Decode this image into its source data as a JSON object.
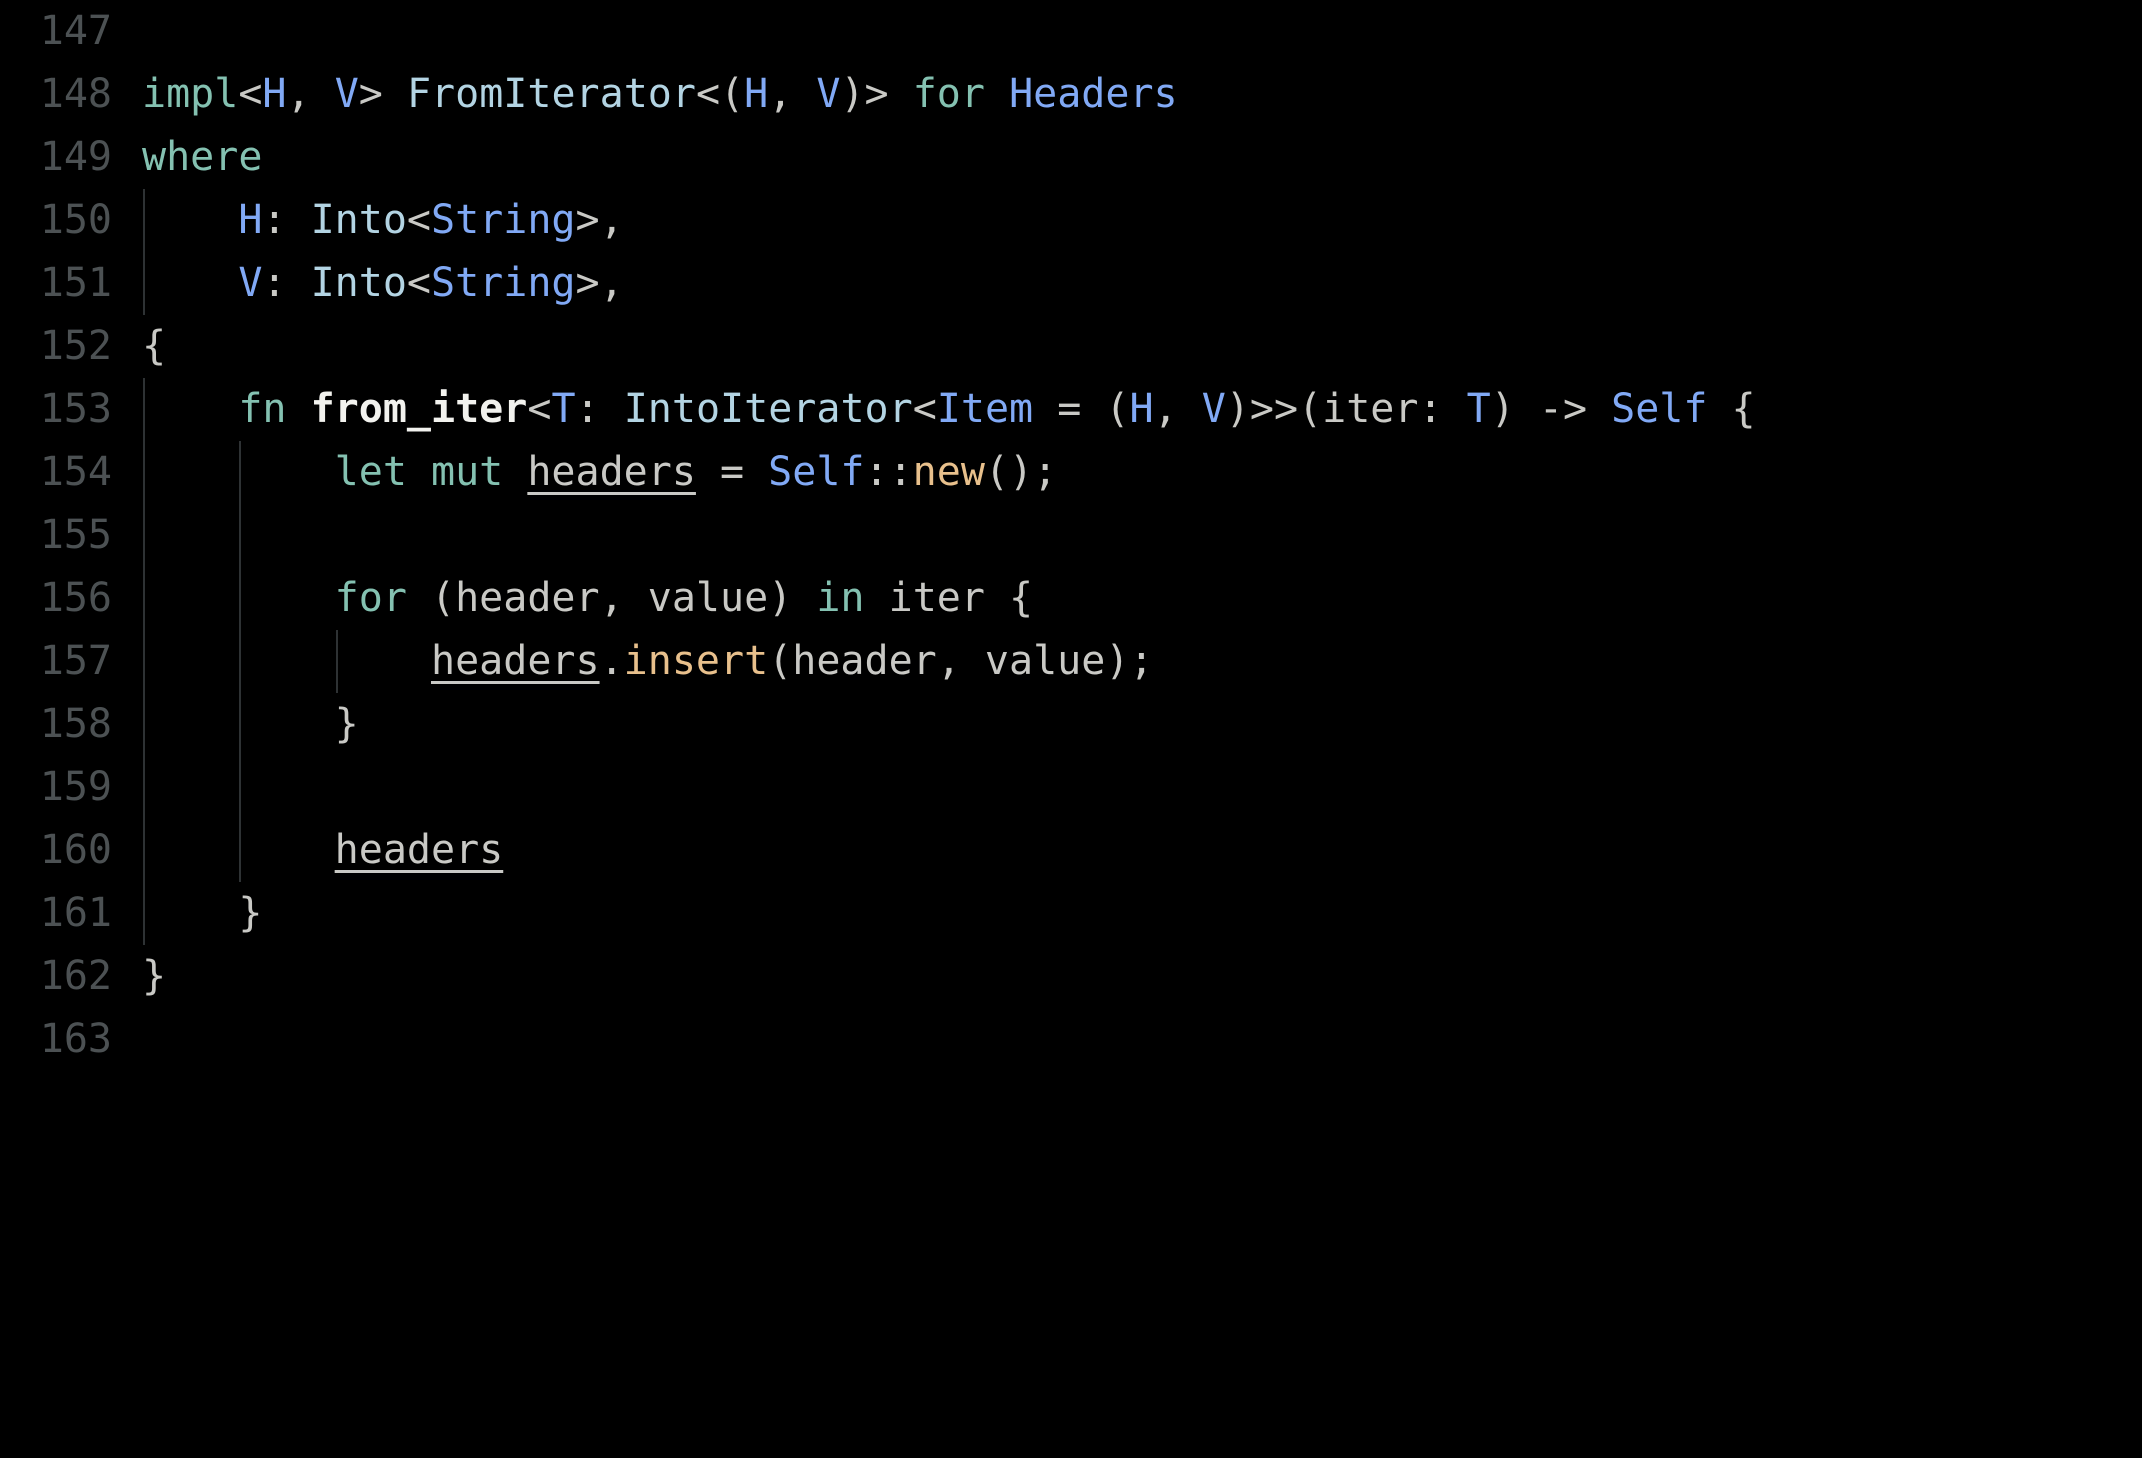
{
  "editor": {
    "language": "rust",
    "background_color": "#000000",
    "gutter_color": "#4c5153",
    "colors": {
      "keyword": "#84c1b1",
      "type": "#81a9f5",
      "trait": "#b3d4e3",
      "function_def": "#f2f2ee",
      "function_call": "#e8c08c",
      "punctuation": "#c9c9c5",
      "indent_guide": "#2e3234"
    },
    "first_line": 147,
    "last_line": 163,
    "lines": [
      {
        "number": "147",
        "guides": [],
        "tokens": []
      },
      {
        "number": "148",
        "guides": [],
        "tokens": [
          {
            "t": "impl",
            "c": "kw"
          },
          {
            "t": "<",
            "c": "pun"
          },
          {
            "t": "H",
            "c": "typ"
          },
          {
            "t": ", ",
            "c": "pun"
          },
          {
            "t": "V",
            "c": "typ"
          },
          {
            "t": "> ",
            "c": "pun"
          },
          {
            "t": "FromIterator",
            "c": "tra"
          },
          {
            "t": "<(",
            "c": "pun"
          },
          {
            "t": "H",
            "c": "typ"
          },
          {
            "t": ", ",
            "c": "pun"
          },
          {
            "t": "V",
            "c": "typ"
          },
          {
            "t": ")> ",
            "c": "pun"
          },
          {
            "t": "for",
            "c": "kw"
          },
          {
            "t": " ",
            "c": "pun"
          },
          {
            "t": "Headers",
            "c": "typ"
          }
        ]
      },
      {
        "number": "149",
        "guides": [],
        "tokens": [
          {
            "t": "where",
            "c": "kw"
          }
        ]
      },
      {
        "number": "150",
        "guides": [
          0
        ],
        "tokens": [
          {
            "t": "    ",
            "c": "pun"
          },
          {
            "t": "H",
            "c": "typ"
          },
          {
            "t": ": ",
            "c": "pun"
          },
          {
            "t": "Into",
            "c": "tra"
          },
          {
            "t": "<",
            "c": "pun"
          },
          {
            "t": "String",
            "c": "typ"
          },
          {
            "t": ">,",
            "c": "pun"
          }
        ]
      },
      {
        "number": "151",
        "guides": [
          0
        ],
        "tokens": [
          {
            "t": "    ",
            "c": "pun"
          },
          {
            "t": "V",
            "c": "typ"
          },
          {
            "t": ": ",
            "c": "pun"
          },
          {
            "t": "Into",
            "c": "tra"
          },
          {
            "t": "<",
            "c": "pun"
          },
          {
            "t": "String",
            "c": "typ"
          },
          {
            "t": ">,",
            "c": "pun"
          }
        ]
      },
      {
        "number": "152",
        "guides": [],
        "tokens": [
          {
            "t": "{",
            "c": "pun"
          }
        ]
      },
      {
        "number": "153",
        "guides": [
          0
        ],
        "tokens": [
          {
            "t": "    ",
            "c": "pun"
          },
          {
            "t": "fn",
            "c": "kw"
          },
          {
            "t": " ",
            "c": "pun"
          },
          {
            "t": "from_iter",
            "c": "fnd"
          },
          {
            "t": "<",
            "c": "pun"
          },
          {
            "t": "T",
            "c": "typ"
          },
          {
            "t": ": ",
            "c": "pun"
          },
          {
            "t": "IntoIterator",
            "c": "tra"
          },
          {
            "t": "<",
            "c": "pun"
          },
          {
            "t": "Item",
            "c": "typ"
          },
          {
            "t": " = (",
            "c": "pun"
          },
          {
            "t": "H",
            "c": "typ"
          },
          {
            "t": ", ",
            "c": "pun"
          },
          {
            "t": "V",
            "c": "typ"
          },
          {
            "t": ")>>(",
            "c": "pun"
          },
          {
            "t": "iter",
            "c": "pun"
          },
          {
            "t": ": ",
            "c": "pun"
          },
          {
            "t": "T",
            "c": "typ"
          },
          {
            "t": ") -> ",
            "c": "pun"
          },
          {
            "t": "Self",
            "c": "typ"
          },
          {
            "t": " {",
            "c": "pun"
          }
        ]
      },
      {
        "number": "154",
        "guides": [
          0,
          1
        ],
        "tokens": [
          {
            "t": "        ",
            "c": "pun"
          },
          {
            "t": "let",
            "c": "kw"
          },
          {
            "t": " ",
            "c": "pun"
          },
          {
            "t": "mut",
            "c": "kw"
          },
          {
            "t": " ",
            "c": "pun"
          },
          {
            "t": "headers",
            "c": "var"
          },
          {
            "t": " = ",
            "c": "pun"
          },
          {
            "t": "Self",
            "c": "typ"
          },
          {
            "t": "::",
            "c": "pun"
          },
          {
            "t": "new",
            "c": "fnc"
          },
          {
            "t": "();",
            "c": "pun"
          }
        ]
      },
      {
        "number": "155",
        "guides": [
          0,
          1
        ],
        "tokens": []
      },
      {
        "number": "156",
        "guides": [
          0,
          1
        ],
        "tokens": [
          {
            "t": "        ",
            "c": "pun"
          },
          {
            "t": "for",
            "c": "kw"
          },
          {
            "t": " (",
            "c": "pun"
          },
          {
            "t": "header",
            "c": "pun"
          },
          {
            "t": ", ",
            "c": "pun"
          },
          {
            "t": "value",
            "c": "pun"
          },
          {
            "t": ") ",
            "c": "pun"
          },
          {
            "t": "in",
            "c": "kw"
          },
          {
            "t": " ",
            "c": "pun"
          },
          {
            "t": "iter",
            "c": "pun"
          },
          {
            "t": " {",
            "c": "pun"
          }
        ]
      },
      {
        "number": "157",
        "guides": [
          0,
          1,
          2
        ],
        "tokens": [
          {
            "t": "            ",
            "c": "pun"
          },
          {
            "t": "headers",
            "c": "var"
          },
          {
            "t": ".",
            "c": "pun"
          },
          {
            "t": "insert",
            "c": "fnc"
          },
          {
            "t": "(",
            "c": "pun"
          },
          {
            "t": "header",
            "c": "pun"
          },
          {
            "t": ", ",
            "c": "pun"
          },
          {
            "t": "value",
            "c": "pun"
          },
          {
            "t": ");",
            "c": "pun"
          }
        ]
      },
      {
        "number": "158",
        "guides": [
          0,
          1
        ],
        "tokens": [
          {
            "t": "        ",
            "c": "pun"
          },
          {
            "t": "}",
            "c": "pun"
          }
        ]
      },
      {
        "number": "159",
        "guides": [
          0,
          1
        ],
        "tokens": []
      },
      {
        "number": "160",
        "guides": [
          0,
          1
        ],
        "tokens": [
          {
            "t": "        ",
            "c": "pun"
          },
          {
            "t": "headers",
            "c": "var"
          }
        ]
      },
      {
        "number": "161",
        "guides": [
          0
        ],
        "tokens": [
          {
            "t": "    ",
            "c": "pun"
          },
          {
            "t": "}",
            "c": "pun"
          }
        ]
      },
      {
        "number": "162",
        "guides": [],
        "tokens": [
          {
            "t": "}",
            "c": "pun"
          }
        ]
      },
      {
        "number": "163",
        "guides": [],
        "tokens": []
      }
    ]
  }
}
